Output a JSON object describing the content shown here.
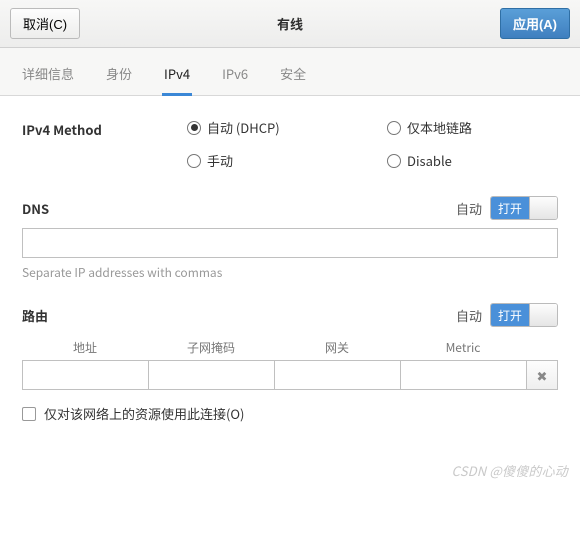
{
  "header": {
    "cancel_label": "取消(C)",
    "title": "有线",
    "apply_label": "应用(A)"
  },
  "tabs": {
    "items": [
      {
        "label": "详细信息",
        "active": false
      },
      {
        "label": "身份",
        "active": false
      },
      {
        "label": "IPv4",
        "active": true
      },
      {
        "label": "IPv6",
        "active": false
      },
      {
        "label": "安全",
        "active": false
      }
    ]
  },
  "ipv4_method": {
    "label": "IPv4 Method",
    "options": [
      {
        "label": "自动 (DHCP)",
        "selected": true
      },
      {
        "label": "仅本地链路",
        "selected": false
      },
      {
        "label": "手动",
        "selected": false
      },
      {
        "label": "Disable",
        "selected": false
      }
    ]
  },
  "dns": {
    "title": "DNS",
    "auto_label": "自动",
    "toggle_on_label": "打开",
    "input_value": "",
    "hint": "Separate IP addresses with commas"
  },
  "routes": {
    "title": "路由",
    "auto_label": "自动",
    "toggle_on_label": "打开",
    "columns": [
      "地址",
      "子网掩码",
      "网关",
      "Metric"
    ],
    "row": {
      "address": "",
      "netmask": "",
      "gateway": "",
      "metric": ""
    },
    "delete_icon": "✖"
  },
  "only_resources": {
    "label": "仅对该网络上的资源使用此连接(O)",
    "checked": false
  },
  "watermark": "CSDN @傻傻的心动"
}
